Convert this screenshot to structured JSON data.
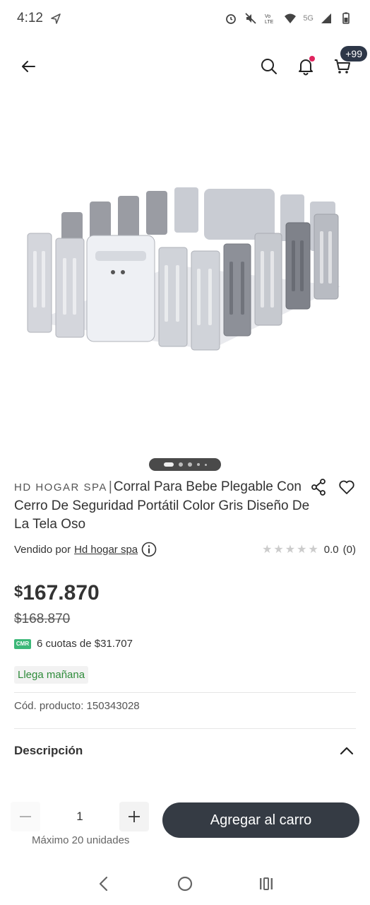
{
  "status_bar": {
    "time": "4:12",
    "network": "5G"
  },
  "header": {
    "cart_count": "+99"
  },
  "product": {
    "image_alt": "Corral plegable gris",
    "carousel": {
      "total": 5,
      "active": 0
    },
    "brand": "HD HOGAR SPA",
    "separator": "|",
    "title": "Corral Para Bebe Plegable Con Cerro De Seguridad Portátil Color Gris Diseño De La Tela Oso",
    "seller_prefix": "Vendido por",
    "seller_name": "Hd hogar spa",
    "rating_value": "0.0",
    "rating_count": "(0)",
    "price_currency": "$",
    "price_current": "167.870",
    "price_old": "$168.870",
    "cmr_label": "CMR",
    "installments": "6 cuotas de $31.707",
    "delivery": "Llega mañana",
    "code_label": "Cód. producto: 150343028"
  },
  "description": {
    "label": "Descripción"
  },
  "purchase": {
    "quantity": "1",
    "max_label": "Máximo 20 unidades",
    "add_button": "Agregar al carro"
  },
  "colors": {
    "primary_button": "#353b44",
    "delivery_green": "#2e8b3a",
    "cmr_green": "#3cb878",
    "notif_red": "#e0245e"
  }
}
